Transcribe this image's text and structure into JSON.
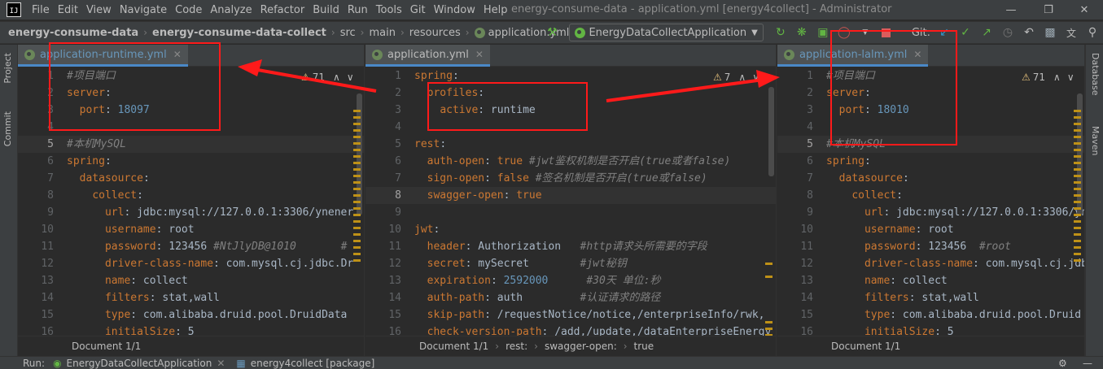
{
  "app": {
    "logo": "IJ",
    "window_title": "energy-consume-data - application.yml [energy4collect] - Administrator"
  },
  "menu": [
    "File",
    "Edit",
    "View",
    "Navigate",
    "Code",
    "Analyze",
    "Refactor",
    "Build",
    "Run",
    "Tools",
    "Git",
    "Window",
    "Help"
  ],
  "breadcrumb": {
    "items": [
      "energy-consume-data",
      "energy-consume-data-collect",
      "src",
      "main",
      "resources",
      "application.yml"
    ]
  },
  "toolbar": {
    "run_config": "EnergyDataCollectApplication",
    "git_label": "Git:"
  },
  "side": {
    "left": [
      "Project",
      "Commit"
    ],
    "right": [
      "Database",
      "Maven"
    ]
  },
  "panes": [
    {
      "tab": "application-runtime.yml",
      "inspection": "71",
      "start_line": 1,
      "current_line": 5,
      "lines": [
        [
          [
            "c",
            "#项目端口"
          ]
        ],
        [
          [
            "k",
            "server"
          ],
          [
            "s",
            ":"
          ]
        ],
        [
          [
            "s",
            "  "
          ],
          [
            "k",
            "port"
          ],
          [
            "s",
            ": "
          ],
          [
            "n",
            "18097"
          ]
        ],
        [
          [
            "s",
            ""
          ]
        ],
        [
          [
            "c",
            "#本机MySQL"
          ]
        ],
        [
          [
            "k",
            "spring"
          ],
          [
            "s",
            ":"
          ]
        ],
        [
          [
            "s",
            "  "
          ],
          [
            "k",
            "datasource"
          ],
          [
            "s",
            ":"
          ]
        ],
        [
          [
            "s",
            "    "
          ],
          [
            "k",
            "collect"
          ],
          [
            "s",
            ":"
          ]
        ],
        [
          [
            "s",
            "      "
          ],
          [
            "k",
            "url"
          ],
          [
            "s",
            ": jdbc:mysql://127.0.0.1:3306/ynener"
          ]
        ],
        [
          [
            "s",
            "      "
          ],
          [
            "k",
            "username"
          ],
          [
            "s",
            ": root"
          ]
        ],
        [
          [
            "s",
            "      "
          ],
          [
            "k",
            "password"
          ],
          [
            "s",
            ": 123456 "
          ],
          [
            "c",
            "#NtJlyDB@1010       #"
          ]
        ],
        [
          [
            "s",
            "      "
          ],
          [
            "k",
            "driver-class-name"
          ],
          [
            "s",
            ": com.mysql.cj.jdbc.Dr"
          ]
        ],
        [
          [
            "s",
            "      "
          ],
          [
            "k",
            "name"
          ],
          [
            "s",
            ": collect"
          ]
        ],
        [
          [
            "s",
            "      "
          ],
          [
            "k",
            "filters"
          ],
          [
            "s",
            ": stat,wall"
          ]
        ],
        [
          [
            "s",
            "      "
          ],
          [
            "k",
            "type"
          ],
          [
            "s",
            ": com.alibaba.druid.pool.DruidData"
          ]
        ],
        [
          [
            "s",
            "      "
          ],
          [
            "k",
            "initialSize"
          ],
          [
            "s",
            ": 5"
          ]
        ]
      ],
      "status": [
        "Document 1/1"
      ]
    },
    {
      "tab": "application.yml",
      "inspection": "7",
      "start_line": 1,
      "current_line": 8,
      "lines": [
        [
          [
            "k",
            "spring"
          ],
          [
            "s",
            ":"
          ]
        ],
        [
          [
            "s",
            "  "
          ],
          [
            "k",
            "profiles"
          ],
          [
            "s",
            ":"
          ]
        ],
        [
          [
            "s",
            "    "
          ],
          [
            "k",
            "active"
          ],
          [
            "s",
            ": runtime"
          ]
        ],
        [
          [
            "s",
            ""
          ]
        ],
        [
          [
            "k",
            "rest"
          ],
          [
            "s",
            ":"
          ]
        ],
        [
          [
            "s",
            "  "
          ],
          [
            "k",
            "auth-open"
          ],
          [
            "s",
            ": "
          ],
          [
            "kw",
            "true"
          ],
          [
            "s",
            " "
          ],
          [
            "c",
            "#jwt鉴权机制是否开启(true或者false)"
          ]
        ],
        [
          [
            "s",
            "  "
          ],
          [
            "k",
            "sign-open"
          ],
          [
            "s",
            ": "
          ],
          [
            "kw",
            "false"
          ],
          [
            "s",
            " "
          ],
          [
            "c",
            "#签名机制是否开启(true或false)"
          ]
        ],
        [
          [
            "s",
            "  "
          ],
          [
            "k",
            "swagger-open"
          ],
          [
            "s",
            ": "
          ],
          [
            "kw",
            "true"
          ]
        ],
        [
          [
            "s",
            ""
          ]
        ],
        [
          [
            "k",
            "jwt"
          ],
          [
            "s",
            ":"
          ]
        ],
        [
          [
            "s",
            "  "
          ],
          [
            "k",
            "header"
          ],
          [
            "s",
            ": Authorization   "
          ],
          [
            "c",
            "#http请求头所需要的字段"
          ]
        ],
        [
          [
            "s",
            "  "
          ],
          [
            "k",
            "secret"
          ],
          [
            "s",
            ": mySecret        "
          ],
          [
            "c",
            "#jwt秘钥"
          ]
        ],
        [
          [
            "s",
            "  "
          ],
          [
            "k",
            "expiration"
          ],
          [
            "s",
            ": "
          ],
          [
            "n",
            "2592000"
          ],
          [
            "s",
            "      "
          ],
          [
            "c",
            "#30天 单位:秒"
          ]
        ],
        [
          [
            "s",
            "  "
          ],
          [
            "k",
            "auth-path"
          ],
          [
            "s",
            ": auth         "
          ],
          [
            "c",
            "#认证请求的路径"
          ]
        ],
        [
          [
            "s",
            "  "
          ],
          [
            "k",
            "skip-path"
          ],
          [
            "s",
            ": /requestNotice/notice,/enterpriseInfo/rwk,"
          ]
        ],
        [
          [
            "s",
            "  "
          ],
          [
            "k",
            "check-version-path"
          ],
          [
            "s",
            ": /add,/update,/dataEnterpriseEnergy"
          ]
        ]
      ],
      "status": [
        "Document 1/1",
        "rest:",
        "swagger-open:",
        "true"
      ]
    },
    {
      "tab": "application-lalm.yml",
      "inspection": "71",
      "start_line": 1,
      "current_line": 5,
      "lines": [
        [
          [
            "c",
            "#项目端口"
          ]
        ],
        [
          [
            "k",
            "server"
          ],
          [
            "s",
            ":"
          ]
        ],
        [
          [
            "s",
            "  "
          ],
          [
            "k",
            "port"
          ],
          [
            "s",
            ": "
          ],
          [
            "n",
            "18010"
          ]
        ],
        [
          [
            "s",
            ""
          ]
        ],
        [
          [
            "c",
            "#本机MySQL"
          ]
        ],
        [
          [
            "k",
            "spring"
          ],
          [
            "s",
            ":"
          ]
        ],
        [
          [
            "s",
            "  "
          ],
          [
            "k",
            "datasource"
          ],
          [
            "s",
            ":"
          ]
        ],
        [
          [
            "s",
            "    "
          ],
          [
            "k",
            "collect"
          ],
          [
            "s",
            ":"
          ]
        ],
        [
          [
            "s",
            "      "
          ],
          [
            "k",
            "url"
          ],
          [
            "s",
            ": jdbc:mysql://127.0.0.1:3306/yn"
          ]
        ],
        [
          [
            "s",
            "      "
          ],
          [
            "k",
            "username"
          ],
          [
            "s",
            ": root"
          ]
        ],
        [
          [
            "s",
            "      "
          ],
          [
            "k",
            "password"
          ],
          [
            "s",
            ": 123456  "
          ],
          [
            "c",
            "#root"
          ]
        ],
        [
          [
            "s",
            "      "
          ],
          [
            "k",
            "driver-class-name"
          ],
          [
            "s",
            ": com.mysql.cj.jdb"
          ]
        ],
        [
          [
            "s",
            "      "
          ],
          [
            "k",
            "name"
          ],
          [
            "s",
            ": collect"
          ]
        ],
        [
          [
            "s",
            "      "
          ],
          [
            "k",
            "filters"
          ],
          [
            "s",
            ": stat,wall"
          ]
        ],
        [
          [
            "s",
            "      "
          ],
          [
            "k",
            "type"
          ],
          [
            "s",
            ": com.alibaba.druid.pool.Druid"
          ]
        ],
        [
          [
            "s",
            "      "
          ],
          [
            "k",
            "initialSize"
          ],
          [
            "s",
            ": 5"
          ]
        ]
      ],
      "status": [
        "Document 1/1"
      ]
    }
  ],
  "bottom": {
    "run_label": "Run:",
    "run_tabs": [
      "EnergyDataCollectApplication",
      "energy4collect [package]"
    ]
  },
  "colors": {
    "annotation": "#ff1a1a",
    "key": "#cc7832",
    "comment": "#808080",
    "number": "#6897bb"
  }
}
